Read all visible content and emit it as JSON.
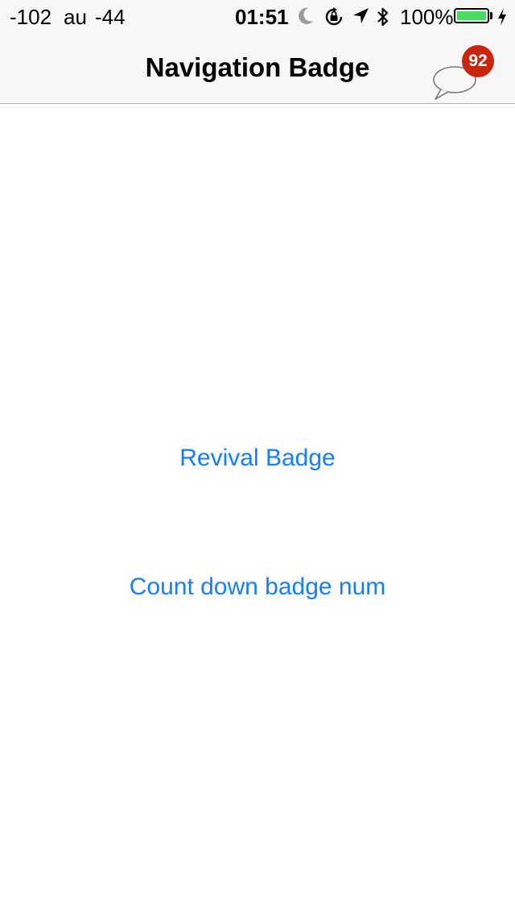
{
  "status_bar": {
    "carrier": "-102",
    "network": "au",
    "signal": "-44",
    "time": "01:51",
    "battery_percent": "100%",
    "icons": [
      "moon-icon",
      "rotation-lock-icon",
      "location-arrow-icon",
      "bluetooth-icon",
      "battery-icon",
      "charging-bolt-icon"
    ],
    "battery_color": "#4cd964"
  },
  "nav": {
    "title": "Navigation Badge",
    "badge_count": "92",
    "badge_color": "#c8250e",
    "right_icon": "chat-bubble-icon"
  },
  "buttons": {
    "revival": "Revival Badge",
    "countdown": "Count down badge num"
  },
  "colors": {
    "accent": "#147efb",
    "bar_background": "#f7f7f7"
  }
}
